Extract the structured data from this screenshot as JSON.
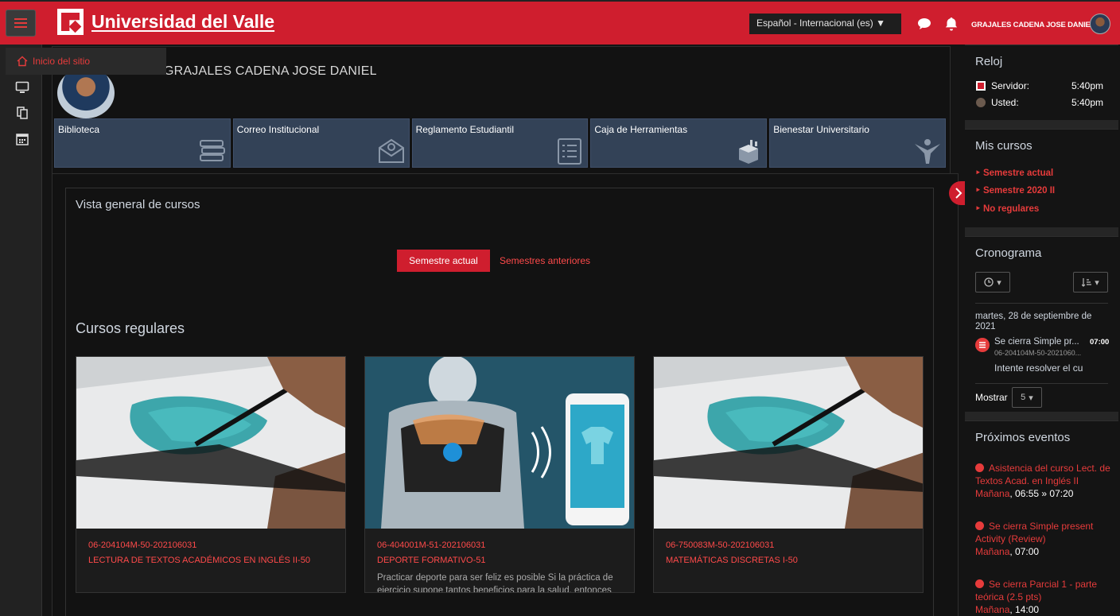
{
  "header": {
    "site_name": "Universidad del Valle",
    "language": "Español - Internacional (es) ▼",
    "user_name": "GRAJALES CADENA JOSE DANIEL"
  },
  "nav": {
    "site_home": "Inicio del sitio"
  },
  "profile": {
    "name": "GRAJALES CADENA JOSE DANIEL"
  },
  "quicklinks": [
    {
      "label": "Biblioteca",
      "icon": "books-icon"
    },
    {
      "label": "Correo Institucional",
      "icon": "envelope-icon"
    },
    {
      "label": "Reglamento Estudiantil",
      "icon": "list-icon"
    },
    {
      "label": "Caja de Herramientas",
      "icon": "toolbox-icon"
    },
    {
      "label": "Bienestar Universitario",
      "icon": "person-icon"
    }
  ],
  "overview": {
    "title": "Vista general de cursos",
    "tab_current": "Semestre actual",
    "tab_previous": "Semestres anteriores",
    "section": "Cursos regulares",
    "courses": [
      {
        "code": "06-204104M-50-202106031",
        "name": "LECTURA DE TEXTOS ACADÉMICOS EN INGLÉS II-50",
        "summary": ""
      },
      {
        "code": "06-404001M-51-202106031",
        "name": "DEPORTE FORMATIVO-51",
        "summary": "Practicar deporte para ser feliz es posible Si la práctica de ejercicio supone tantos beneficios para la salud, entonces ¿por qué nos ..."
      },
      {
        "code": "06-750083M-50-202106031",
        "name": "MATEMÁTICAS DISCRETAS I-50",
        "summary": ""
      }
    ]
  },
  "clock": {
    "title": "Reloj",
    "server_label": "Servidor:",
    "server_time": "5:40pm",
    "user_label": "Usted:",
    "user_time": "5:40pm"
  },
  "mycourses": {
    "title": "Mis cursos",
    "items": [
      "Semestre actual",
      "Semestre 2020 II",
      "No regulares"
    ]
  },
  "timeline": {
    "title": "Cronograma",
    "date": "martes, 28 de septiembre de 2021",
    "event_title": "Se cierra Simple pr...",
    "event_time": "07:00",
    "event_course": "06-204104M-50-2021060...",
    "event_action": "Intente resolver el cu",
    "show_label": "Mostrar",
    "show_value": "5"
  },
  "upcoming": {
    "title": "Próximos eventos",
    "events": [
      {
        "name": "Asistencia del curso Lect. de Textos Acad. en Inglés II",
        "day": "Mañana",
        "time": ", 06:55 » 07:20"
      },
      {
        "name": "Se cierra Simple present Activity (Review)",
        "day": "Mañana",
        "time": ", 07:00"
      },
      {
        "name": "Se cierra Parcial 1 - parte teórica (2.5 pts)",
        "day": "Mañana",
        "time": ", 14:00"
      }
    ]
  },
  "colors": {
    "brand_red": "#cf1e2e",
    "link_red": "#ff4a4a",
    "tile_blue": "#334257"
  }
}
